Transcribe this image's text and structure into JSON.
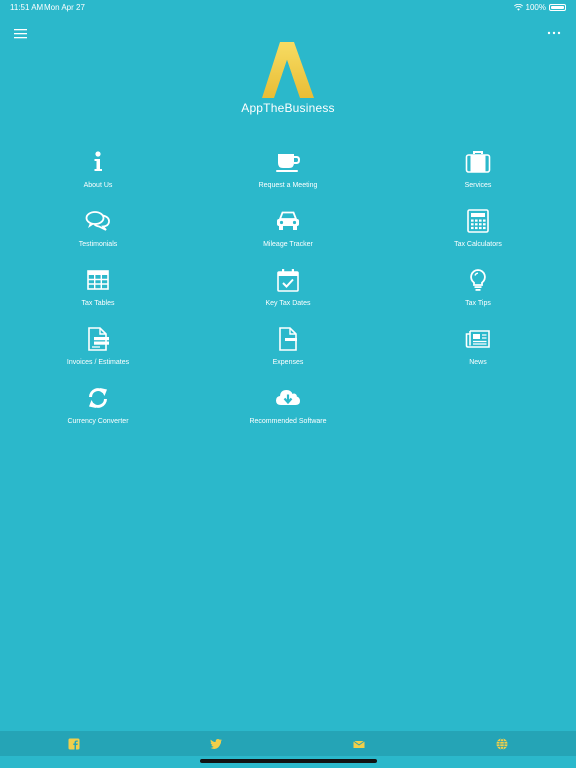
{
  "status": {
    "time": "11:51 AM",
    "date": "Mon Apr 27",
    "battery": "100%"
  },
  "brand": {
    "name": "AppTheBusiness",
    "logo_letter": "A"
  },
  "menu": [
    {
      "label": "About Us",
      "icon": "info-icon"
    },
    {
      "label": "Request a Meeting",
      "icon": "coffee-cup-icon"
    },
    {
      "label": "Services",
      "icon": "briefcase-icon"
    },
    {
      "label": "Testimonials",
      "icon": "speech-bubbles-icon"
    },
    {
      "label": "Mileage Tracker",
      "icon": "car-icon"
    },
    {
      "label": "Tax Calculators",
      "icon": "calculator-icon"
    },
    {
      "label": "Tax Tables",
      "icon": "table-icon"
    },
    {
      "label": "Key Tax Dates",
      "icon": "calendar-check-icon"
    },
    {
      "label": "Tax Tips",
      "icon": "lightbulb-icon"
    },
    {
      "label": "Invoices / Estimates",
      "icon": "invoice-icon"
    },
    {
      "label": "Expenses",
      "icon": "document-icon"
    },
    {
      "label": "News",
      "icon": "newspaper-icon"
    },
    {
      "label": "Currency Converter",
      "icon": "refresh-arrows-icon"
    },
    {
      "label": "Recommended Software",
      "icon": "cloud-download-icon"
    }
  ],
  "bottom_bar": [
    "facebook-icon",
    "twitter-icon",
    "mail-icon",
    "globe-icon"
  ],
  "colors": {
    "background": "#2bb8cb",
    "bottom_bar": "#25a4b6",
    "accent": "#f2cf4a"
  }
}
